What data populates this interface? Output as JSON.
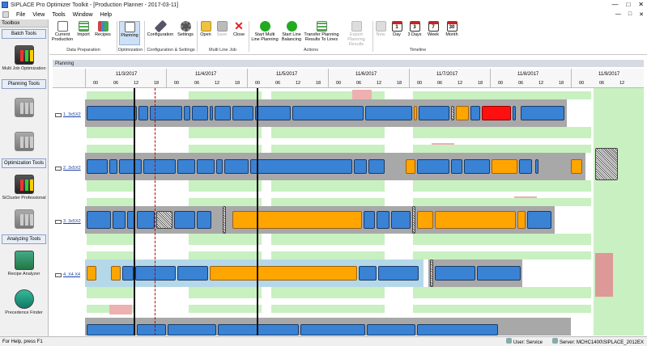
{
  "window": {
    "title": "SIPLACE Pro Optimizer Toolkit - [Production Planner - 2017-03-11]",
    "controls": [
      "—",
      "□",
      "✕"
    ]
  },
  "menubar": {
    "items": [
      "File",
      "View",
      "Tools",
      "Window",
      "Help"
    ],
    "mdi_controls": [
      "—",
      "□",
      "✕"
    ]
  },
  "toolbox": {
    "header": "Toolbox",
    "sections": [
      {
        "label": "Batch Tools"
      },
      {
        "label": "Planning Tools"
      },
      {
        "label": "Optimization Tools"
      },
      {
        "label": "Analyzing Tools"
      }
    ],
    "tools": [
      {
        "label": "Multi Job Optimization",
        "icon": "traffic-light-icon"
      },
      {
        "label": "",
        "icon": "planning-icon"
      },
      {
        "label": "",
        "icon": "planning-icon"
      },
      {
        "label": "SiCluster Professional",
        "icon": "sicluster-icon"
      },
      {
        "label": "",
        "icon": "optimization-icon"
      },
      {
        "label": "Recipe Analyzer",
        "icon": "recipe-analyzer-icon"
      },
      {
        "label": "Precedence Finder",
        "icon": "precedence-finder-icon"
      }
    ]
  },
  "ribbon": {
    "buttons": {
      "current_production": "Current\nProduction",
      "import": "Import",
      "recipes": "Recipes",
      "planning": "Planning",
      "configuration": "Configuration",
      "settings": "Settings",
      "open": "Open",
      "save": "Save",
      "close": "Close",
      "start_multi_line": "Start Multi\nLine Planning",
      "start_line_balancing": "Start Line\nBalancing",
      "transfer_planning": "Transfer Planning\nResults To Lines",
      "export_planning": "Export Planning\nResults",
      "now": "Now",
      "day": "Day",
      "three_days": "3 Days",
      "week": "Week",
      "month": "Month",
      "day_num": "1",
      "three_days_num": "3",
      "week_num": "7",
      "month_num": "30"
    },
    "groups": {
      "data_preparation": "Data Preparation",
      "optimization": "Optimization",
      "config_settings": "Configuration & Settings",
      "multi_line_job": "Multi Line Job",
      "actions": "Actions",
      "timeline": "Timeline"
    }
  },
  "planning": {
    "header": "Planning",
    "days": [
      "11/3/2017",
      "11/4/2017",
      "11/5/2017",
      "11/6/2017",
      "11/7/2017",
      "11/8/2017",
      "11/9/2017"
    ],
    "hour_ticks": [
      "00",
      "06",
      "12",
      "18"
    ],
    "rows": [
      {
        "label": "1. 3x5X2"
      },
      {
        "label": "2. 3x5X2"
      },
      {
        "label": "3. 3x5X2"
      },
      {
        "label": "4. X4 X4"
      },
      {
        "label": ""
      }
    ]
  },
  "colors": {
    "job_blue": "#3a82d4",
    "job_orange": "#ffa500",
    "job_red": "#ff1010",
    "available_green": "#c8f0c0",
    "unavailable_red": "#dd9898"
  },
  "status": {
    "help": "For Help, press F1",
    "user_label": "User:",
    "user": "Service",
    "server_label": "Server:",
    "server": "MCHC1400\\SIPLACE_2012EX"
  }
}
